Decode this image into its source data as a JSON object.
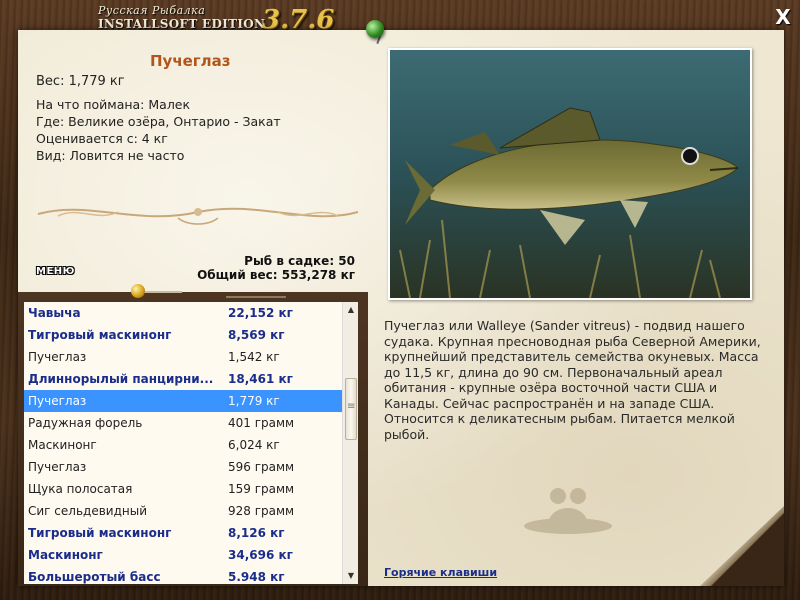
{
  "header": {
    "logo_subtitle": "Русская Рыбалка",
    "edition": "INSTALLSOFT EDITION",
    "version": "3.7.6",
    "close_label": "X"
  },
  "fish": {
    "title": "Пучеглаз",
    "weight": "Вес: 1,779 кг",
    "bait": "На что поймана: Малек",
    "location": "Где: Великие озёра, Онтарио - Закат",
    "valued_from": "Оценивается с: 4 кг",
    "kind": "Вид: Ловится не часто"
  },
  "stats": {
    "fish_in_net": "Рыб в садке: 50",
    "total_weight": "Общий вес: 553,278 кг"
  },
  "menu_label": "МЕНЮ",
  "catch_list": [
    {
      "name": "Чавыча",
      "weight": "22,152 кг",
      "bold": true
    },
    {
      "name": "Тигровый маскинонг",
      "weight": "8,569 кг",
      "bold": true
    },
    {
      "name": "Пучеглаз",
      "weight": "1,542 кг",
      "bold": false
    },
    {
      "name": "Длиннорылый панцирни...",
      "weight": "18,461 кг",
      "bold": true
    },
    {
      "name": "Пучеглаз",
      "weight": "1,779 кг",
      "bold": false,
      "selected": true
    },
    {
      "name": "Радужная форель",
      "weight": "401 грамм",
      "bold": false
    },
    {
      "name": "Маскинонг",
      "weight": "6,024 кг",
      "bold": false
    },
    {
      "name": "Пучеглаз",
      "weight": "596 грамм",
      "bold": false
    },
    {
      "name": "Щука полосатая",
      "weight": "159 грамм",
      "bold": false
    },
    {
      "name": "Сиг сельдевидный",
      "weight": "928 грамм",
      "bold": false
    },
    {
      "name": "Тигровый маскинонг",
      "weight": "8,126 кг",
      "bold": true
    },
    {
      "name": "Маскинонг",
      "weight": "34,696 кг",
      "bold": true
    },
    {
      "name": "Большеротый басс",
      "weight": "5.948 кг",
      "bold": true
    }
  ],
  "description": "Пучеглаз или Walleye (Sander vitreus) - подвид нашего судака. Крупная пресноводная рыба Северной Америки, крупнейший представитель семейства окуневых. Масса до 11,5 кг, длина до 90 см. Первоначальный ареал обитания - крупные озёра восточной части США и Канады. Сейчас распространён и на западе США. Относится к деликатесным рыбам. Питается мелкой рыбой.",
  "hotkeys_label": "Горячие клавиши",
  "colors": {
    "title": "#b0561a",
    "bold_row": "#1a2d8a",
    "selected_row": "#3a93ff",
    "version": "#e8c24a"
  }
}
